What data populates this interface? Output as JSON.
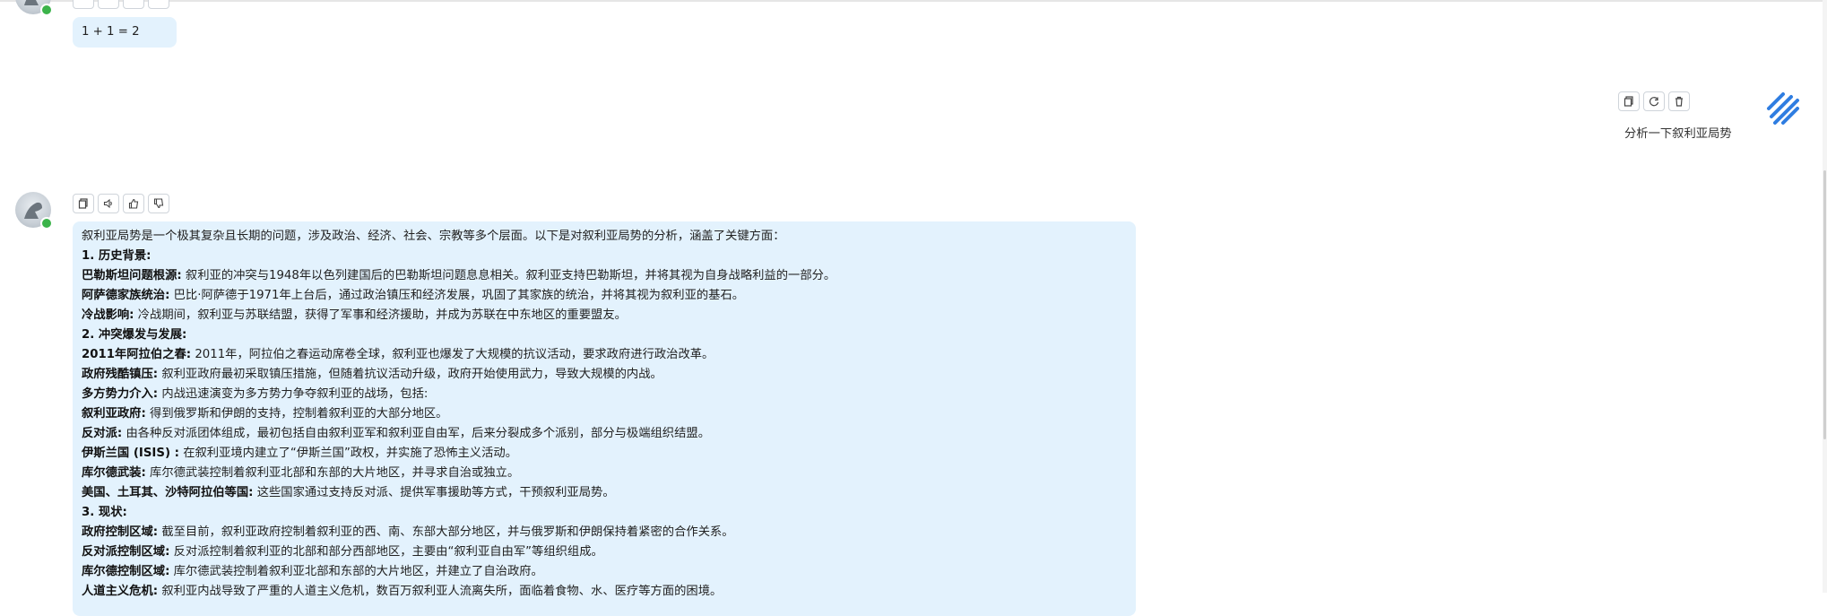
{
  "messages": {
    "first_reply": {
      "text": "1 + 1 = 2"
    },
    "user_question": {
      "text": "分析一下叙利亚局势"
    },
    "assistant_reply": {
      "lines": [
        {
          "bold": "",
          "text": "叙利亚局势是一个极其复杂且长期的问题，涉及政治、经济、社会、宗教等多个层面。以下是对叙利亚局势的分析，涵盖了关键方面："
        },
        {
          "bold": "1. 历史背景:",
          "text": ""
        },
        {
          "bold": "巴勒斯坦问题根源:",
          "text": " 叙利亚的冲突与1948年以色列建国后的巴勒斯坦问题息息相关。叙利亚支持巴勒斯坦，并将其视为自身战略利益的一部分。"
        },
        {
          "bold": "阿萨德家族统治:",
          "text": " 巴比·阿萨德于1971年上台后，通过政治镇压和经济发展，巩固了其家族的统治，并将其视为叙利亚的基石。"
        },
        {
          "bold": "冷战影响:",
          "text": " 冷战期间，叙利亚与苏联结盟，获得了军事和经济援助，并成为苏联在中东地区的重要盟友。"
        },
        {
          "bold": "2. 冲突爆发与发展:",
          "text": ""
        },
        {
          "bold": "2011年阿拉伯之春:",
          "text": " 2011年，阿拉伯之春运动席卷全球，叙利亚也爆发了大规模的抗议活动，要求政府进行政治改革。"
        },
        {
          "bold": "政府残酷镇压:",
          "text": " 叙利亚政府最初采取镇压措施，但随着抗议活动升级，政府开始使用武力，导致大规模的内战。"
        },
        {
          "bold": "多方势力介入:",
          "text": " 内战迅速演变为多方势力争夺叙利亚的战场，包括:"
        },
        {
          "bold": "叙利亚政府:",
          "text": " 得到俄罗斯和伊朗的支持，控制着叙利亚的大部分地区。"
        },
        {
          "bold": "反对派:",
          "text": " 由各种反对派团体组成，最初包括自由叙利亚军和叙利亚自由军，后来分裂成多个派别，部分与极端组织结盟。"
        },
        {
          "bold": "伊斯兰国 (ISIS) :",
          "text": " 在叙利亚境内建立了“伊斯兰国”政权，并实施了恐怖主义活动。"
        },
        {
          "bold": "库尔德武装:",
          "text": " 库尔德武装控制着叙利亚北部和东部的大片地区，并寻求自治或独立。"
        },
        {
          "bold": "美国、土耳其、沙特阿拉伯等国:",
          "text": " 这些国家通过支持反对派、提供军事援助等方式，干预叙利亚局势。"
        },
        {
          "bold": "3. 现状:",
          "text": ""
        },
        {
          "bold": "政府控制区域:",
          "text": " 截至目前，叙利亚政府控制着叙利亚的西、南、东部大部分地区，并与俄罗斯和伊朗保持着紧密的合作关系。"
        },
        {
          "bold": "反对派控制区域:",
          "text": " 反对派控制着叙利亚的北部和部分西部地区，主要由“叙利亚自由军”等组织组成。"
        },
        {
          "bold": "库尔德控制区域:",
          "text": " 库尔德武装控制着叙利亚北部和东部的大片地区，并建立了自治政府。"
        },
        {
          "bold": "人道主义危机:",
          "text": " 叙利亚内战导致了严重的人道主义危机，数百万叙利亚人流离失所，面临着食物、水、医疗等方面的困境。"
        }
      ]
    }
  },
  "toolbars": {
    "assistant_actions": [
      "copy-icon",
      "speaker-icon",
      "thumbs-up-icon",
      "thumbs-down-icon"
    ],
    "user_actions": [
      "copy-icon",
      "refresh-icon",
      "delete-icon"
    ]
  },
  "colors": {
    "bubble_bg": "#e3f2fd",
    "online": "#3bb34a",
    "logo": "#2f7de1"
  }
}
